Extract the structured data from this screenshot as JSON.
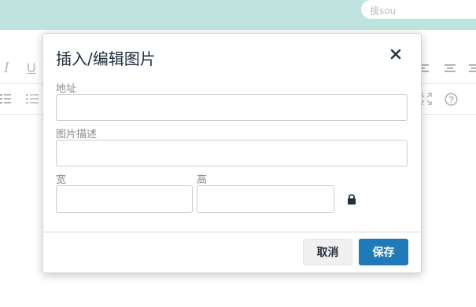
{
  "search": {
    "placeholder": "搜sou"
  },
  "dialog": {
    "title": "插入/编辑图片",
    "fields": {
      "address_label": "地址",
      "address_value": "",
      "desc_label": "图片描述",
      "desc_value": "",
      "width_label": "宽",
      "width_value": "",
      "height_label": "高",
      "height_value": ""
    },
    "buttons": {
      "cancel": "取消",
      "save": "保存"
    }
  },
  "toolbar": {
    "italic_glyph": "I",
    "underline_glyph": "U"
  },
  "colors": {
    "topbar": "#bfe3de",
    "primary": "#207ab7",
    "dialog_text": "#222f3e"
  },
  "icons": {
    "close": "close-icon",
    "lock": "lock-icon",
    "align_left": "align-left-icon",
    "align_center": "align-center-icon",
    "align_right": "align-right-icon",
    "bullet_list": "bullet-list-icon",
    "numbered_list": "numbered-list-icon",
    "fullscreen": "fullscreen-icon",
    "help": "help-icon"
  }
}
